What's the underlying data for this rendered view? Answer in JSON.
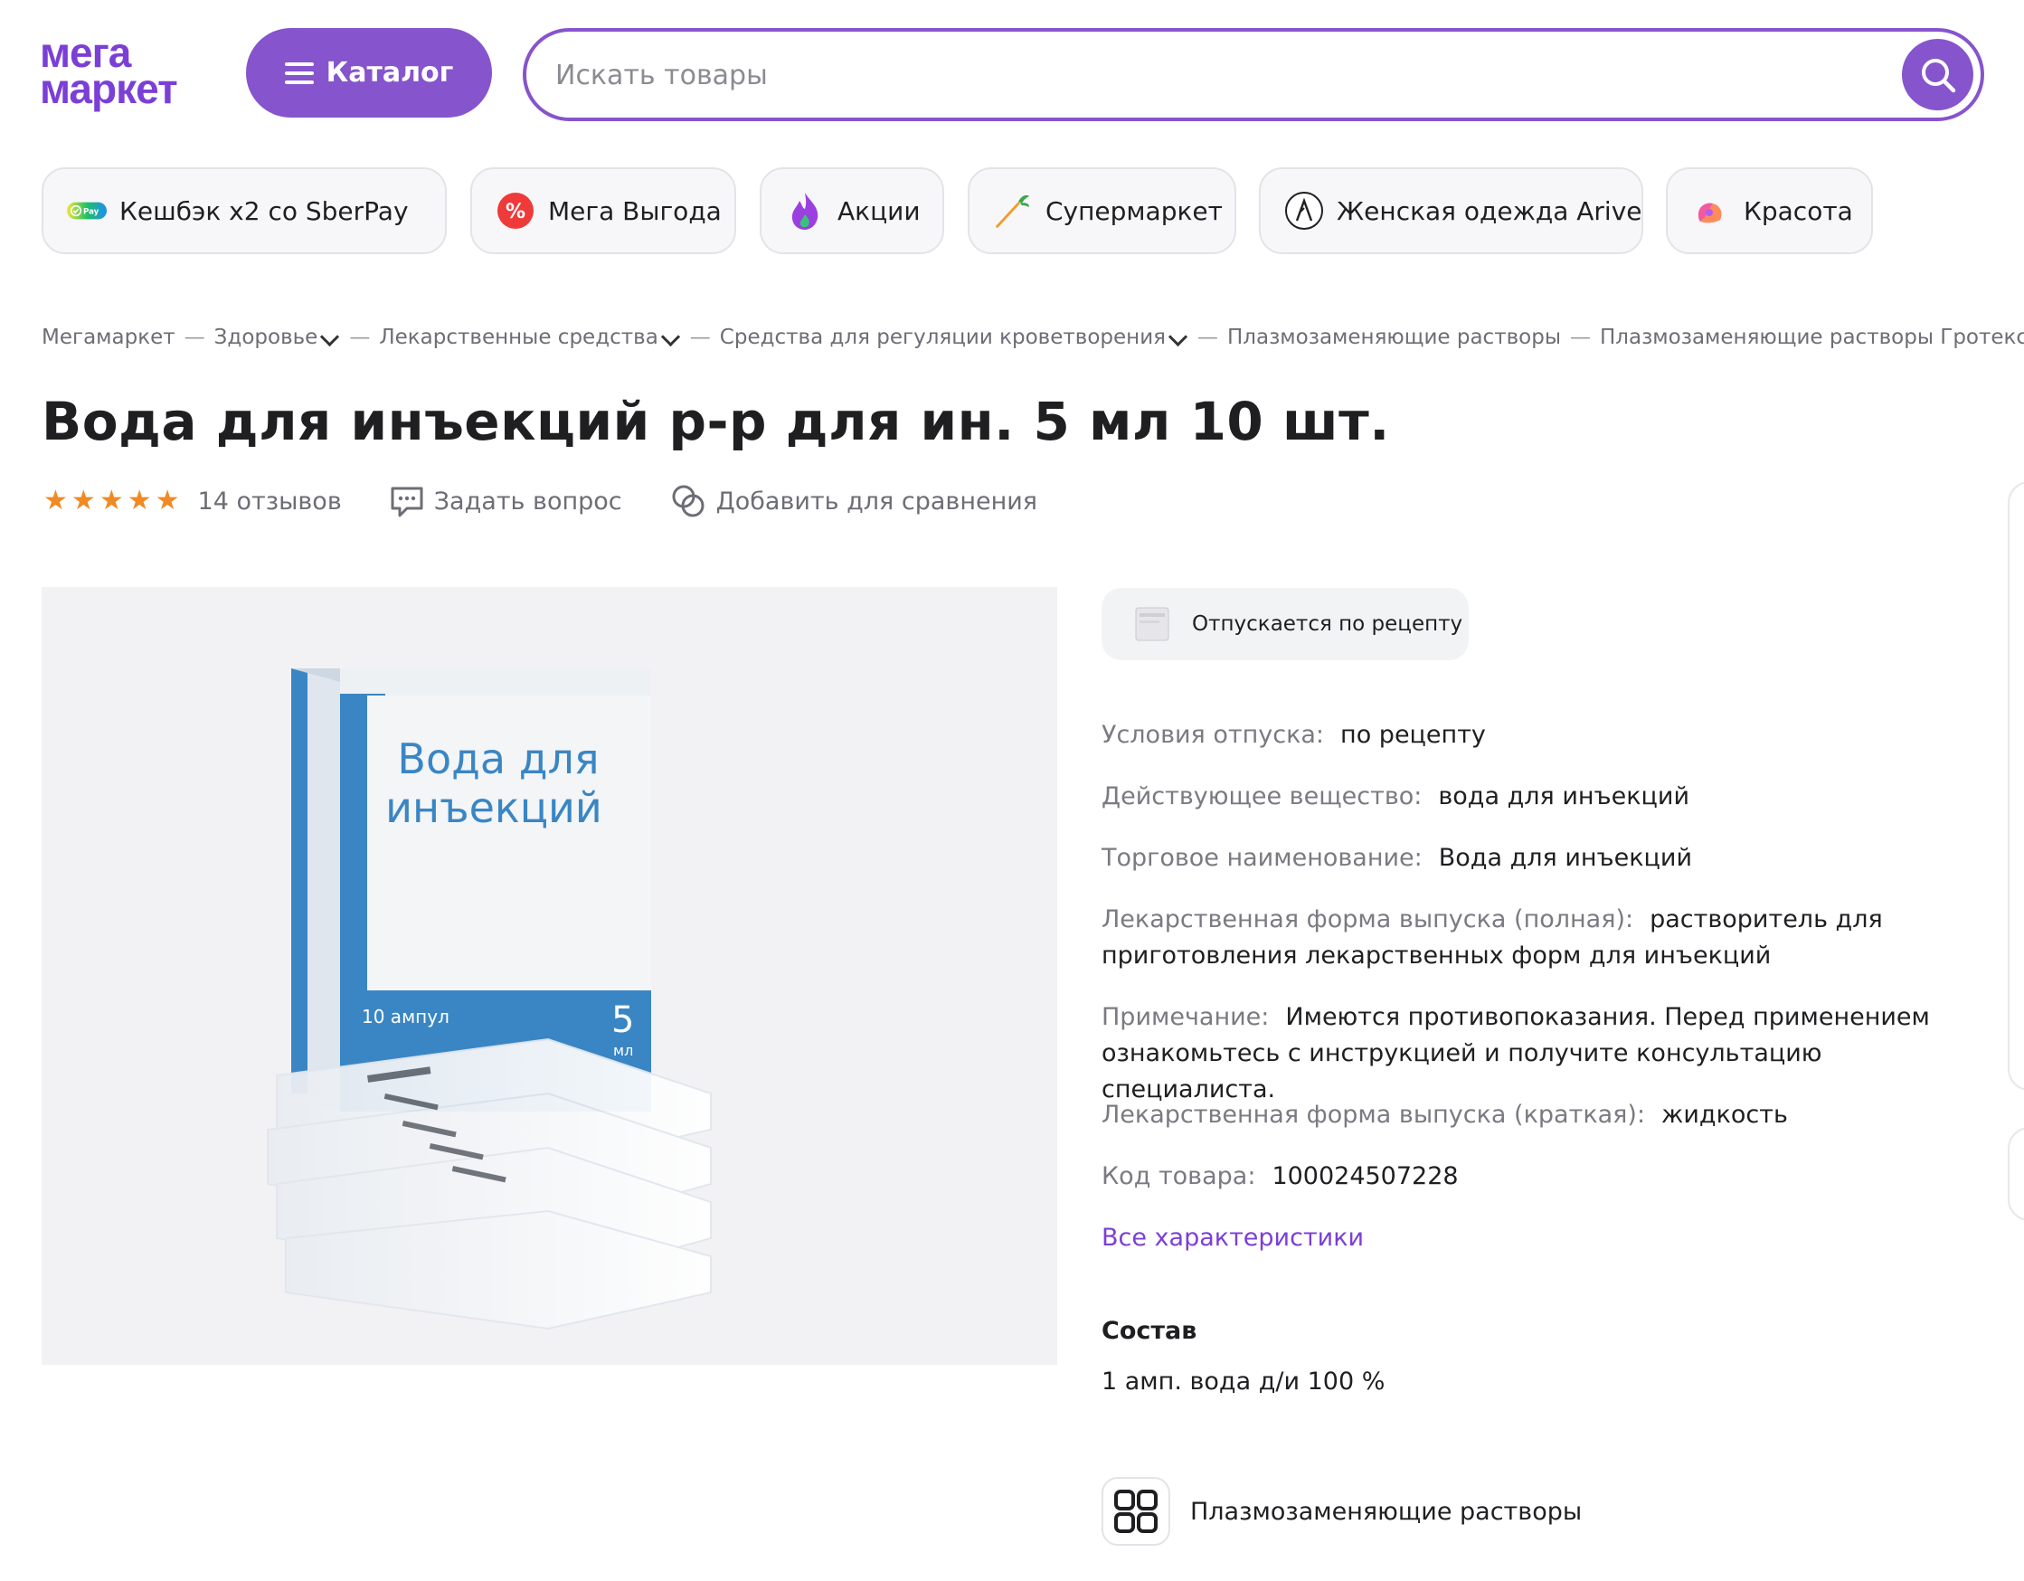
{
  "header": {
    "logo_line1": "мега",
    "logo_line2": "маркет",
    "catalog_label": "Каталог",
    "search_placeholder": "Искать товары"
  },
  "promo_chips": [
    {
      "label": "Кешбэк х2 со SberPay",
      "icon": "sberpay-icon"
    },
    {
      "label": "Мега Выгода",
      "icon": "percent-icon"
    },
    {
      "label": "Акции",
      "icon": "flame-icon"
    },
    {
      "label": "Супермаркет",
      "icon": "carrot-icon"
    },
    {
      "label": "Женская одежда Arive",
      "icon": "arive-logo-icon"
    },
    {
      "label": "Красота",
      "icon": "beauty-icon"
    }
  ],
  "breadcrumb": [
    {
      "label": "Мегамаркет",
      "dropdown": false
    },
    {
      "label": "Здоровье",
      "dropdown": true
    },
    {
      "label": "Лекарственные средства",
      "dropdown": true
    },
    {
      "label": "Средства для регуляции кроветворения",
      "dropdown": true
    },
    {
      "label": "Плазмозаменяющие растворы",
      "dropdown": false
    },
    {
      "label": "Плазмозаменяющие растворы Гротекс ООО",
      "dropdown": false
    }
  ],
  "breadcrumb_separator": "—",
  "product": {
    "title": "Вода для инъекций р-р для ин. 5 мл 10 шт.",
    "rating_stars": 5,
    "reviews": "14 отзывов",
    "ask_question": "Задать вопрос",
    "compare": "Добавить для сравнения",
    "image": {
      "box_title_line1": "Вода для",
      "box_title_line2": "инъекций",
      "box_count": "10 ампул",
      "box_volume": "5",
      "box_volume_unit": "мл"
    }
  },
  "rx_badge": "Отпускается по рецепту",
  "specs": [
    {
      "key": "Условия отпуска:",
      "value": "по рецепту"
    },
    {
      "key": "Действующее вещество:",
      "value": "вода для инъекций"
    },
    {
      "key": "Торговое наименование:",
      "value": "Вода для инъекций"
    },
    {
      "key": "Лекарственная форма выпуска (полная):",
      "value": "растворитель для приготовления лекарственных форм для инъекций"
    },
    {
      "key": "Примечание:",
      "value": "Имеются противопоказания. Перед применением ознакомьтесь с инструкцией и получите консультацию специалиста."
    },
    {
      "key": "Лекарственная форма выпуска (краткая):",
      "value": "жидкость"
    },
    {
      "key": "Код товара:",
      "value": "100024507228"
    }
  ],
  "all_specs_link": "Все характеристики",
  "composition": {
    "title": "Состав",
    "text": "1 амп. вода д/и 100 %"
  },
  "category_link": "Плазмозаменяющие растворы",
  "colors": {
    "brand": "#7b3fd6",
    "button": "#8654cc",
    "star": "#f08a24",
    "muted_text": "#7a7a82"
  }
}
